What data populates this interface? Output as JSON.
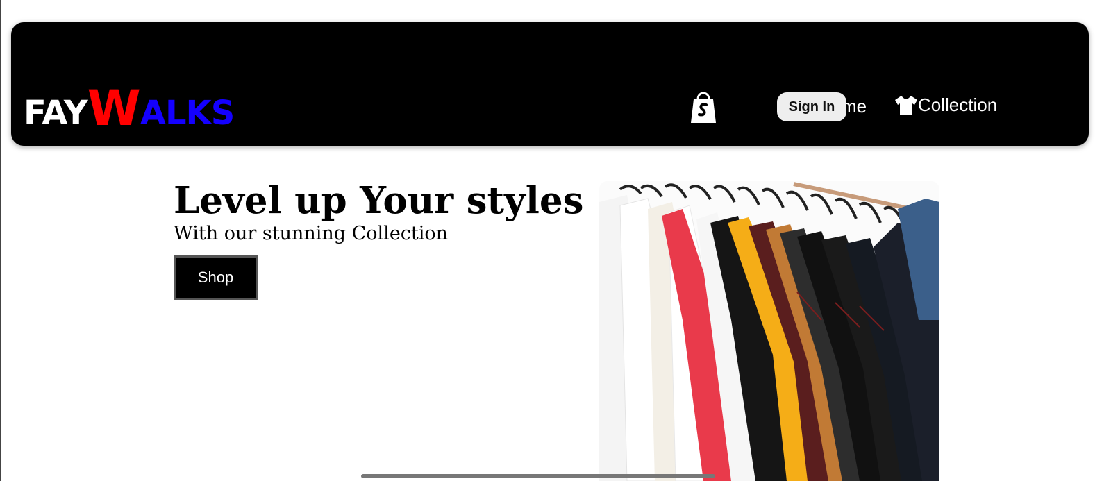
{
  "brand": {
    "part1": "FAY",
    "part2": "W",
    "part3": "ALKS",
    "colors": {
      "part1": "#ffffff",
      "part2": "#ff0000",
      "part3": "#1400ff"
    }
  },
  "nav": {
    "cart_icon": "shopify-bag-icon",
    "signin_label": "Sign In",
    "home_label": "me",
    "collection_icon": "tshirt-icon",
    "collection_label": "Collection"
  },
  "hero": {
    "title": "Level up Your styles",
    "subtitle": "With our stunning Collection",
    "shop_label": "Shop",
    "image_description_icon": "clothes-rack-image"
  },
  "colors": {
    "navbar_bg": "#000000",
    "page_bg": "#ffffff",
    "button_bg": "#000000"
  }
}
